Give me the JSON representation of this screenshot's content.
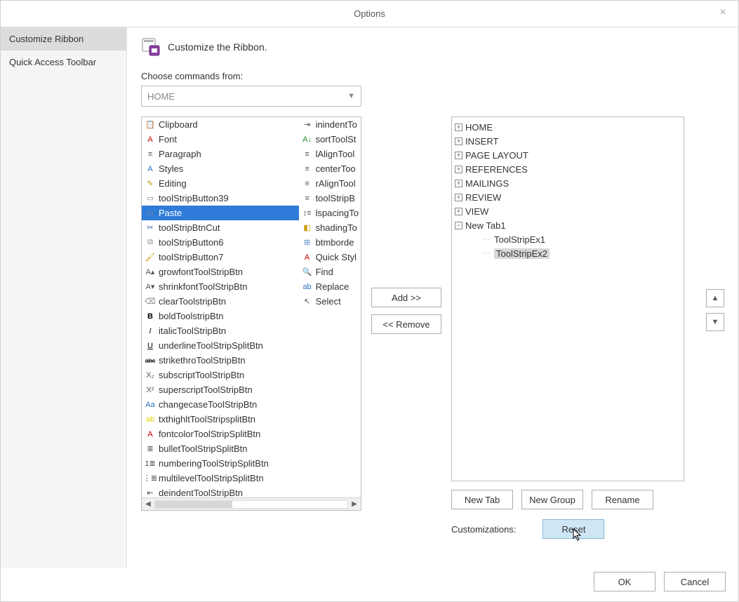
{
  "window": {
    "title": "Options"
  },
  "sidebar": {
    "items": [
      {
        "label": "Customize Ribbon",
        "selected": true
      },
      {
        "label": "Quick Access Toolbar",
        "selected": false
      }
    ]
  },
  "header": {
    "title": "Customize the Ribbon."
  },
  "choose": {
    "label": "Choose commands from:",
    "value": "HOME"
  },
  "commands_col1": [
    {
      "label": "Clipboard",
      "icon": "clipboard-icon",
      "color": "#6a6a6a"
    },
    {
      "label": "Font",
      "icon": "font-a-icon",
      "color": "#c00000"
    },
    {
      "label": "Paragraph",
      "icon": "paragraph-lines-icon",
      "color": "#555"
    },
    {
      "label": "Styles",
      "icon": "styles-aa-icon",
      "color": "#2a6fbf"
    },
    {
      "label": "Editing",
      "icon": "pencil-icon",
      "color": "#c79a00"
    },
    {
      "label": "toolStripButton39",
      "icon": "button-icon",
      "color": "#888"
    },
    {
      "label": "Paste",
      "icon": "paste-icon",
      "color": "#888",
      "selected": true
    },
    {
      "label": "toolStripBtnCut",
      "icon": "scissors-icon",
      "color": "#3b5aa0"
    },
    {
      "label": "toolStripButton6",
      "icon": "copy-icon",
      "color": "#888"
    },
    {
      "label": "toolStripButton7",
      "icon": "brush-icon",
      "color": "#c79a00"
    },
    {
      "label": "growfontToolStripBtn",
      "icon": "grow-font-icon",
      "color": "#555"
    },
    {
      "label": "shrinkfontToolStripBtn",
      "icon": "shrink-font-icon",
      "color": "#555"
    },
    {
      "label": "clearToolstripBtn",
      "icon": "eraser-icon",
      "color": "#888"
    },
    {
      "label": "boldToolstripBtn",
      "icon": "bold-icon",
      "color": "#000"
    },
    {
      "label": "italicToolStripBtn",
      "icon": "italic-icon",
      "color": "#000"
    },
    {
      "label": "underlineToolStripSplitBtn",
      "icon": "underline-icon",
      "color": "#000"
    },
    {
      "label": "strikethroToolStripBtn",
      "icon": "strike-icon",
      "color": "#000"
    },
    {
      "label": "subscriptToolStripBtn",
      "icon": "subscript-icon",
      "color": "#555"
    },
    {
      "label": "superscriptToolStripBtn",
      "icon": "superscript-icon",
      "color": "#555"
    },
    {
      "label": "changecaseToolStripBtn",
      "icon": "changecase-icon",
      "color": "#2a6fbf"
    },
    {
      "label": "txthighltToolStripsplitBtn",
      "icon": "highlight-icon",
      "color": "#e6d200"
    },
    {
      "label": "fontcolorToolStripSplitBtn",
      "icon": "font-color-icon",
      "color": "#c00000"
    },
    {
      "label": "bulletToolStripSplitBtn",
      "icon": "bullets-icon",
      "color": "#555"
    },
    {
      "label": "numberingToolStripSplitBtn",
      "icon": "numbering-icon",
      "color": "#555"
    },
    {
      "label": "multilevelToolStripSplitBtn",
      "icon": "multilevel-icon",
      "color": "#555"
    },
    {
      "label": "deindentToolStripBtn",
      "icon": "deindent-icon",
      "color": "#555"
    }
  ],
  "commands_col2": [
    {
      "label": "inindentTo",
      "icon": "indent-icon",
      "color": "#555"
    },
    {
      "label": "sortToolSt",
      "icon": "sort-icon",
      "color": "#2a8a2a"
    },
    {
      "label": "lAlignTool",
      "icon": "align-left-icon",
      "color": "#555"
    },
    {
      "label": "centerToo",
      "icon": "align-center-icon",
      "color": "#555"
    },
    {
      "label": "rAlignTool",
      "icon": "align-right-icon",
      "color": "#555"
    },
    {
      "label": "toolStripB",
      "icon": "justify-icon",
      "color": "#555"
    },
    {
      "label": "lspacingTo",
      "icon": "line-spacing-icon",
      "color": "#555"
    },
    {
      "label": "shadingTo",
      "icon": "shading-icon",
      "color": "#c79a00"
    },
    {
      "label": "btmborde",
      "icon": "border-icon",
      "color": "#5a8ac6"
    },
    {
      "label": "Quick Styl",
      "icon": "quick-styles-icon",
      "color": "#c00000"
    },
    {
      "label": "Find",
      "icon": "find-icon",
      "color": "#2a6fbf"
    },
    {
      "label": "Replace",
      "icon": "replace-icon",
      "color": "#2a6fbf"
    },
    {
      "label": "Select",
      "icon": "select-icon",
      "color": "#555"
    }
  ],
  "transfer": {
    "add": "Add >>",
    "remove": "<< Remove"
  },
  "tree": {
    "nodes": [
      {
        "label": "HOME",
        "expanded": false
      },
      {
        "label": "INSERT",
        "expanded": false
      },
      {
        "label": "PAGE LAYOUT",
        "expanded": false
      },
      {
        "label": "REFERENCES",
        "expanded": false
      },
      {
        "label": "MAILINGS",
        "expanded": false
      },
      {
        "label": "REVIEW",
        "expanded": false
      },
      {
        "label": "VIEW",
        "expanded": false
      },
      {
        "label": "New Tab1",
        "expanded": true,
        "children": [
          {
            "label": "ToolStripEx1",
            "selected": false
          },
          {
            "label": "ToolStripEx2",
            "selected": true
          }
        ]
      }
    ]
  },
  "buttons": {
    "new_tab": "New Tab",
    "new_group": "New Group",
    "rename": "Rename",
    "customizations_label": "Customizations:",
    "reset": "Reset",
    "ok": "OK",
    "cancel": "Cancel"
  }
}
